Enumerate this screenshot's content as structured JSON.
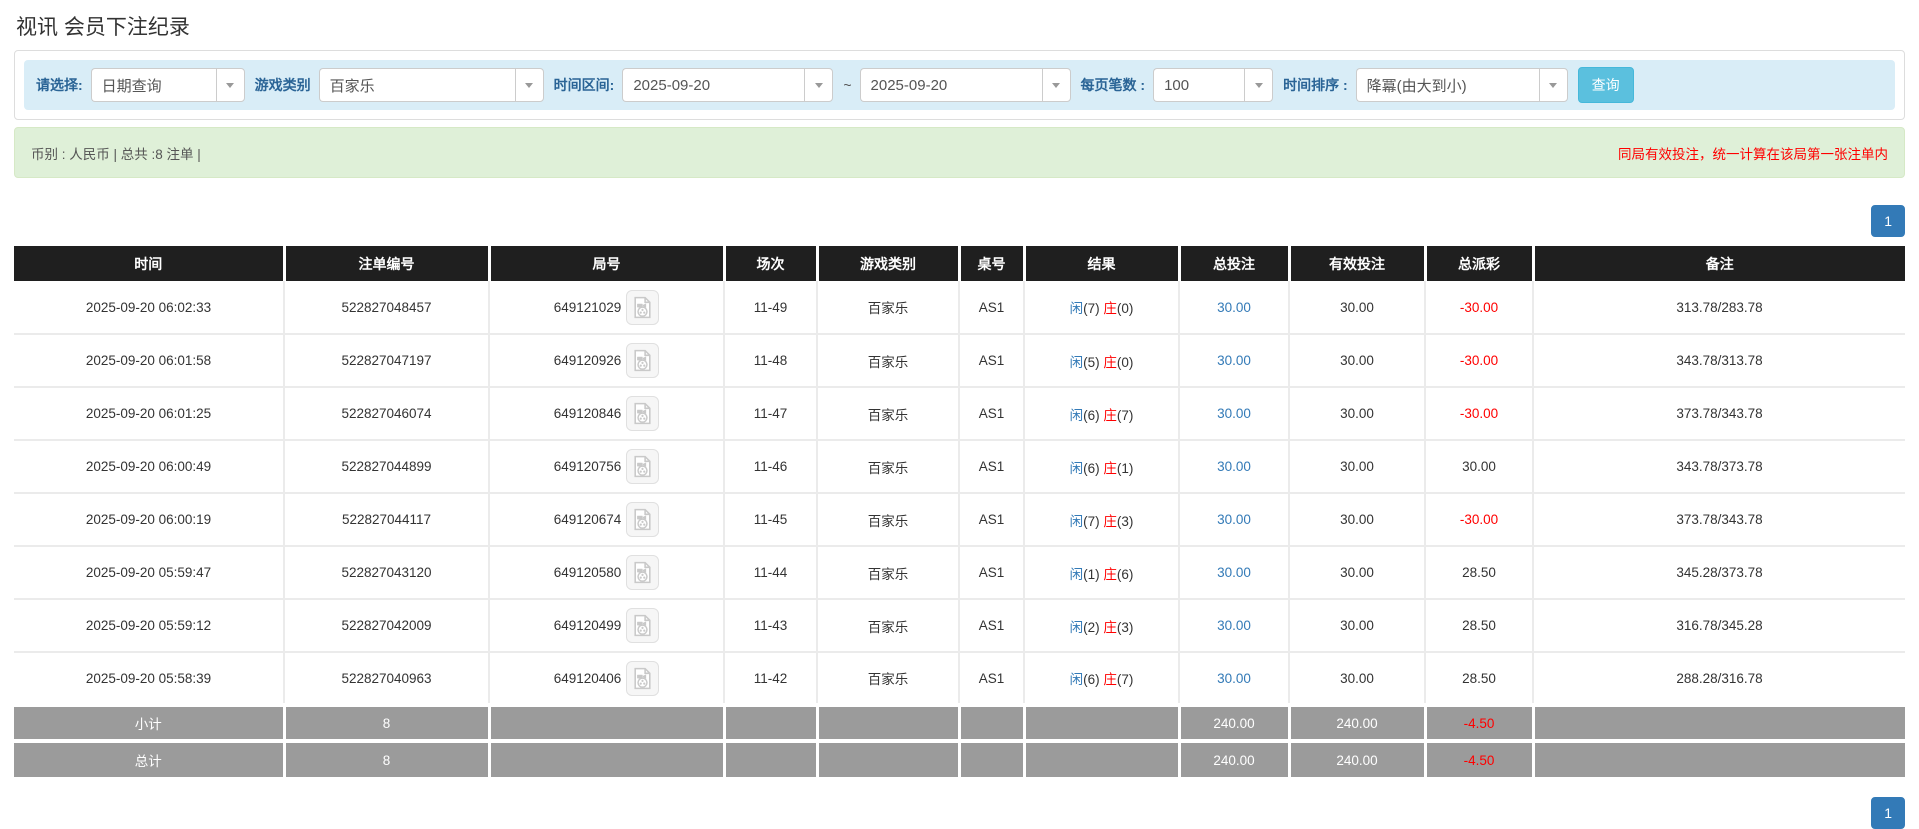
{
  "page": {
    "title": "视讯 会员下注纪录"
  },
  "filters": {
    "select_label": "请选择:",
    "query_type": "日期查询",
    "game_label": "游戏类别",
    "game": "百家乐",
    "range_label": "时间区间:",
    "date_from": "2025-09-20",
    "range_sep": "~",
    "date_to": "2025-09-20",
    "per_page_label": "每页笔数 :",
    "per_page": "100",
    "sort_label": "时间排序 :",
    "sort": "降冪(由大到小)",
    "query_button": "查询"
  },
  "summary": {
    "left": "币别 : 人民币 | 总共 :8 注单 |",
    "note": "同局有效投注，统一计算在该局第一张注单内"
  },
  "pagination": {
    "page": "1"
  },
  "table": {
    "columns": [
      "时间",
      "注单编号",
      "局号",
      "场次",
      "游戏类别",
      "桌号",
      "结果",
      "总投注",
      "有效投注",
      "总派彩",
      "备注"
    ],
    "result_labels": {
      "player": "闲",
      "banker": "庄"
    },
    "video_icon": "video-replay-icon",
    "rows": [
      {
        "time": "2025-09-20 06:02:33",
        "bet_id": "522827048457",
        "round_id": "649121029",
        "session": "11-49",
        "game": "百家乐",
        "table_no": "AS1",
        "player": "7",
        "banker": "0",
        "total_bet": "30.00",
        "valid_bet": "30.00",
        "payout": "-30.00",
        "note": "313.78/283.78"
      },
      {
        "time": "2025-09-20 06:01:58",
        "bet_id": "522827047197",
        "round_id": "649120926",
        "session": "11-48",
        "game": "百家乐",
        "table_no": "AS1",
        "player": "5",
        "banker": "0",
        "total_bet": "30.00",
        "valid_bet": "30.00",
        "payout": "-30.00",
        "note": "343.78/313.78"
      },
      {
        "time": "2025-09-20 06:01:25",
        "bet_id": "522827046074",
        "round_id": "649120846",
        "session": "11-47",
        "game": "百家乐",
        "table_no": "AS1",
        "player": "6",
        "banker": "7",
        "total_bet": "30.00",
        "valid_bet": "30.00",
        "payout": "-30.00",
        "note": "373.78/343.78"
      },
      {
        "time": "2025-09-20 06:00:49",
        "bet_id": "522827044899",
        "round_id": "649120756",
        "session": "11-46",
        "game": "百家乐",
        "table_no": "AS1",
        "player": "6",
        "banker": "1",
        "total_bet": "30.00",
        "valid_bet": "30.00",
        "payout": "30.00",
        "note": "343.78/373.78"
      },
      {
        "time": "2025-09-20 06:00:19",
        "bet_id": "522827044117",
        "round_id": "649120674",
        "session": "11-45",
        "game": "百家乐",
        "table_no": "AS1",
        "player": "7",
        "banker": "3",
        "total_bet": "30.00",
        "valid_bet": "30.00",
        "payout": "-30.00",
        "note": "373.78/343.78"
      },
      {
        "time": "2025-09-20 05:59:47",
        "bet_id": "522827043120",
        "round_id": "649120580",
        "session": "11-44",
        "game": "百家乐",
        "table_no": "AS1",
        "player": "1",
        "banker": "6",
        "total_bet": "30.00",
        "valid_bet": "30.00",
        "payout": "28.50",
        "note": "345.28/373.78"
      },
      {
        "time": "2025-09-20 05:59:12",
        "bet_id": "522827042009",
        "round_id": "649120499",
        "session": "11-43",
        "game": "百家乐",
        "table_no": "AS1",
        "player": "2",
        "banker": "3",
        "total_bet": "30.00",
        "valid_bet": "30.00",
        "payout": "28.50",
        "note": "316.78/345.28"
      },
      {
        "time": "2025-09-20 05:58:39",
        "bet_id": "522827040963",
        "round_id": "649120406",
        "session": "11-42",
        "game": "百家乐",
        "table_no": "AS1",
        "player": "6",
        "banker": "7",
        "total_bet": "30.00",
        "valid_bet": "30.00",
        "payout": "28.50",
        "note": "288.28/316.78"
      }
    ],
    "subtotal": {
      "label": "小计",
      "count": "8",
      "total_bet": "240.00",
      "valid_bet": "240.00",
      "payout": "-4.50"
    },
    "total": {
      "label": "总计",
      "count": "8",
      "total_bet": "240.00",
      "valid_bet": "240.00",
      "payout": "-4.50"
    }
  }
}
